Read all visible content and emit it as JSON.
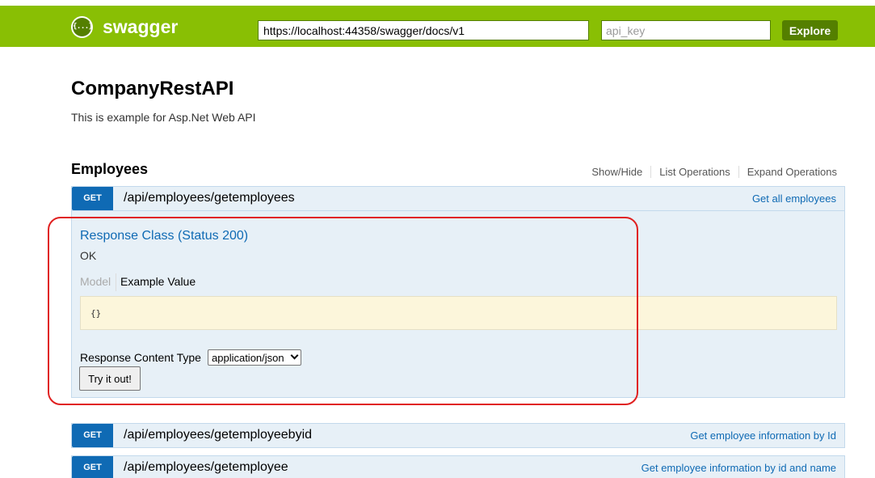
{
  "header": {
    "logo_text": "swagger",
    "logo_icon": "{...}",
    "url_value": "https://localhost:44358/swagger/docs/v1",
    "api_key_placeholder": "api_key",
    "explore_label": "Explore",
    "colors": {
      "bar": "#89bf04",
      "accent": "#547f00"
    }
  },
  "info": {
    "title": "CompanyRestAPI",
    "description": "This is example for Asp.Net Web API"
  },
  "resource": {
    "name": "Employees",
    "links": [
      "Show/Hide",
      "List Operations",
      "Expand Operations"
    ]
  },
  "operations": [
    {
      "method": "GET",
      "path": "/api/employees/getemployees",
      "summary": "Get all employees",
      "expanded": true,
      "response": {
        "heading": "Response Class (Status 200)",
        "status_text": "OK",
        "model_tab": "Model",
        "example_tab": "Example Value",
        "example_value": "{}",
        "content_type_label": "Response Content Type",
        "content_type_selected": "application/json",
        "try_label": "Try it out!"
      }
    },
    {
      "method": "GET",
      "path": "/api/employees/getemployeebyid",
      "summary": "Get employee information by Id",
      "expanded": false
    },
    {
      "method": "GET",
      "path": "/api/employees/getemployee",
      "summary": "Get employee information by id and name",
      "expanded": false
    }
  ],
  "colors": {
    "get_verb": "#0f6ab4",
    "op_bg": "#e7f0f7",
    "highlight": "#e02020"
  }
}
